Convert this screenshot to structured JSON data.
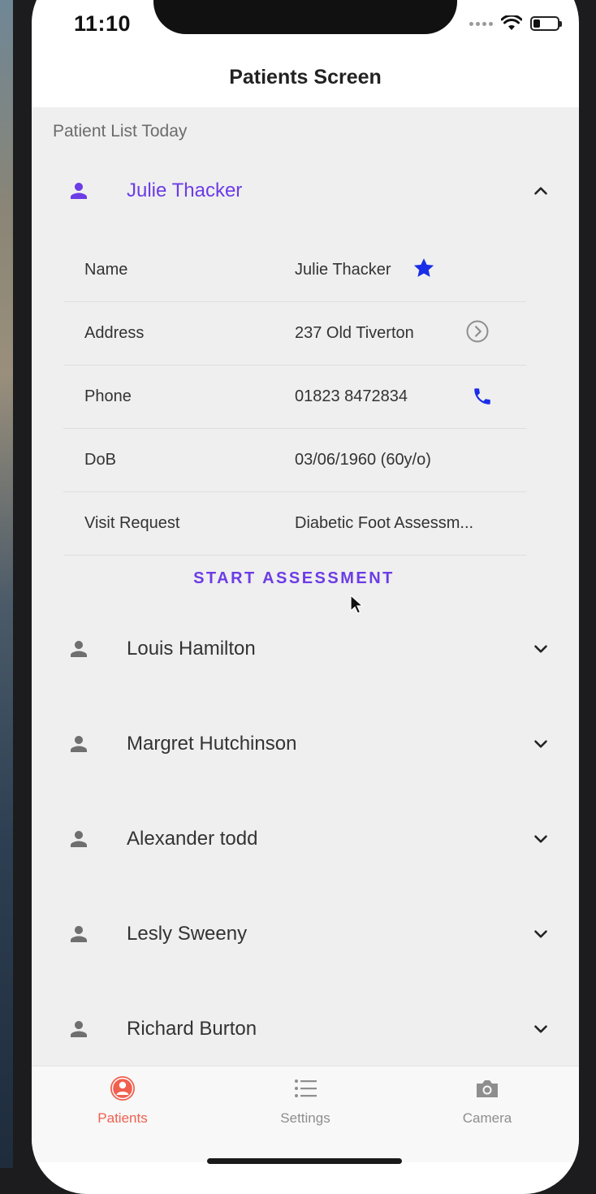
{
  "status_bar": {
    "time": "11:10"
  },
  "header": {
    "title": "Patients Screen"
  },
  "list": {
    "section_label": "Patient List Today",
    "expanded_patient": {
      "name": "Julie Thacker",
      "details": [
        {
          "label": "Name",
          "value": "Julie Thacker",
          "icon": "star-icon"
        },
        {
          "label": "Address",
          "value": "237 Old Tiverton",
          "icon": "chevron-right-circle-icon"
        },
        {
          "label": "Phone",
          "value": "01823 8472834",
          "icon": "phone-icon"
        },
        {
          "label": "DoB",
          "value": "03/06/1960 (60y/o)"
        },
        {
          "label": "Visit Request",
          "value": "Diabetic Foot Assessm..."
        }
      ],
      "action_label": "START ASSESSMENT"
    },
    "patients": [
      {
        "name": "Louis Hamilton"
      },
      {
        "name": "Margret Hutchinson"
      },
      {
        "name": "Alexander todd"
      },
      {
        "name": "Lesly Sweeny"
      },
      {
        "name": "Richard Burton"
      }
    ]
  },
  "tabs": [
    {
      "label": "Patients",
      "icon": "patients-icon",
      "active": true
    },
    {
      "label": "Settings",
      "icon": "list-icon",
      "active": false
    },
    {
      "label": "Camera",
      "icon": "camera-icon",
      "active": false
    }
  ],
  "colors": {
    "accent_purple": "#6c3ce6",
    "icon_blue": "#1a2ee8",
    "tab_active": "#f0604f",
    "list_background": "#efefef"
  }
}
